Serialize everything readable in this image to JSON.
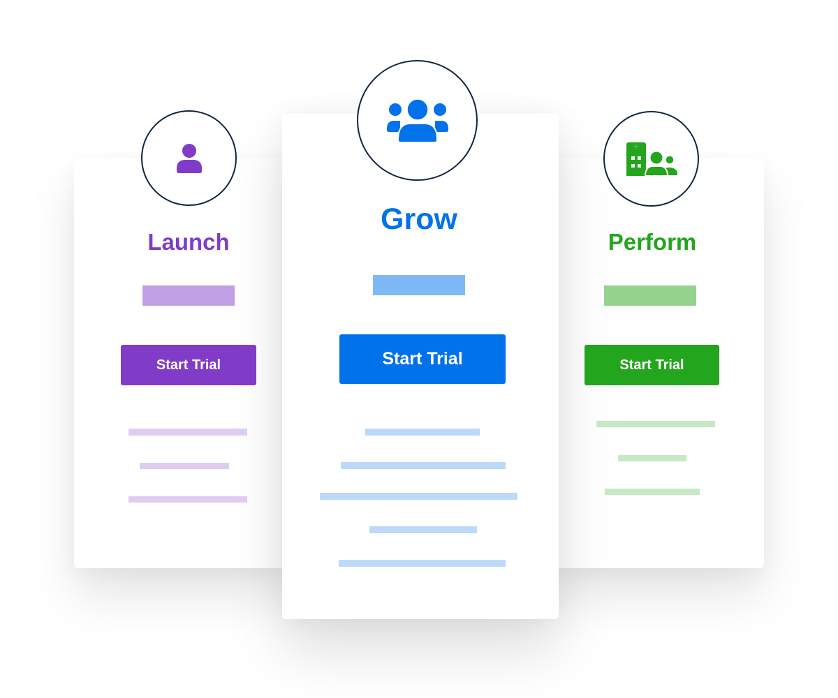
{
  "plans": [
    {
      "id": "launch",
      "name": "Launch",
      "icon": "user-icon",
      "cta_label": "Start Trial",
      "colors": {
        "primary": "#803cc9",
        "price_bar": "#c19fe3",
        "feature_line": "#dfcdf1"
      },
      "feature_line_count": 3
    },
    {
      "id": "grow",
      "name": "Grow",
      "icon": "users-group-icon",
      "cta_label": "Start Trial",
      "colors": {
        "primary": "#0272eb",
        "price_bar": "#7fb8f7",
        "feature_line": "#bcdaf8"
      },
      "feature_line_count": 5,
      "highlighted": true
    },
    {
      "id": "perform",
      "name": "Perform",
      "icon": "hospital-users-icon",
      "cta_label": "Start Trial",
      "colors": {
        "primary": "#23a51d",
        "price_bar": "#93d38e",
        "feature_line": "#c7e8c6"
      },
      "feature_line_count": 3
    }
  ],
  "badge_border_color": "#0f2541"
}
